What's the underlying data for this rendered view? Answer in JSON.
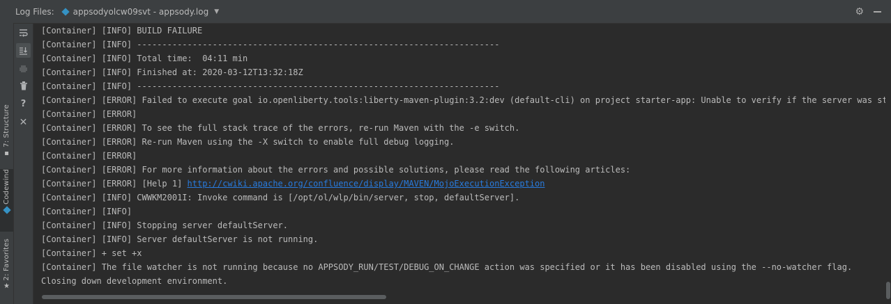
{
  "header": {
    "label": "Log Files:",
    "file_name": "appsodyolcw09svt - appsody.log",
    "dropdown_icon": "chevron-down-icon",
    "settings_icon": "gear-icon",
    "hide_icon": "minimize-icon"
  },
  "side_tabs": {
    "structure": "7: Structure",
    "codewind": "Codewind",
    "favorites": "2: Favorites"
  },
  "toolbar": {
    "icons": [
      "soft-wrap-icon",
      "scroll-to-end-icon",
      "print-icon",
      "clear-all-icon",
      "help-icon",
      "close-icon"
    ]
  },
  "console": {
    "lines": [
      "[Container] [INFO] BUILD FAILURE",
      "[Container] [INFO] ------------------------------------------------------------------------",
      "[Container] [INFO] Total time:  04:11 min",
      "[Container] [INFO] Finished at: 2020-03-12T13:32:18Z",
      "[Container] [INFO] ------------------------------------------------------------------------",
      "[Container] [ERROR] Failed to execute goal io.openliberty.tools:liberty-maven-plugin:3.2:dev (default-cli) on project starter-app: Unable to verify if the server was started",
      "[Container] [ERROR]",
      "[Container] [ERROR] To see the full stack trace of the errors, re-run Maven with the -e switch.",
      "[Container] [ERROR] Re-run Maven using the -X switch to enable full debug logging.",
      "[Container] [ERROR]",
      "[Container] [ERROR] For more information about the errors and possible solutions, please read the following articles:",
      "[Container] [ERROR] [Help 1] ",
      "[Container] [INFO] CWWKM2001I: Invoke command is [/opt/ol/wlp/bin/server, stop, defaultServer].",
      "[Container] [INFO]",
      "[Container] [INFO] Stopping server defaultServer.",
      "[Container] [INFO] Server defaultServer is not running.",
      "[Container] + set +x",
      "[Container] The file watcher is not running because no APPSODY_RUN/TEST/DEBUG_ON_CHANGE action was specified or it has been disabled using the --no-watcher flag.",
      "Closing down development environment."
    ],
    "help_link": "http://cwiki.apache.org/confluence/display/MAVEN/MojoExecutionException"
  }
}
